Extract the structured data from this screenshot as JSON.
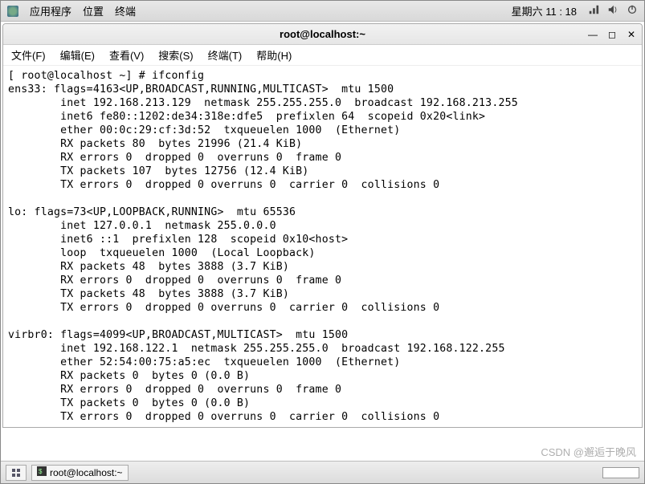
{
  "topbar": {
    "apps": "应用程序",
    "places": "位置",
    "terminal": "终端",
    "clock": "星期六 11 : 18"
  },
  "window": {
    "title": "root@localhost:~"
  },
  "menubar": {
    "file": "文件(F)",
    "edit": "编辑(E)",
    "view": "查看(V)",
    "search": "搜索(S)",
    "terminal": "终端(T)",
    "help": "帮助(H)"
  },
  "terminal": {
    "prompt": "[ root@localhost ~] # ifconfig",
    "lines": [
      "ens33: flags=4163<UP,BROADCAST,RUNNING,MULTICAST>  mtu 1500",
      "        inet 192.168.213.129  netmask 255.255.255.0  broadcast 192.168.213.255",
      "        inet6 fe80::1202:de34:318e:dfe5  prefixlen 64  scopeid 0x20<link>",
      "        ether 00:0c:29:cf:3d:52  txqueuelen 1000  (Ethernet)",
      "        RX packets 80  bytes 21996 (21.4 KiB)",
      "        RX errors 0  dropped 0  overruns 0  frame 0",
      "        TX packets 107  bytes 12756 (12.4 KiB)",
      "        TX errors 0  dropped 0 overruns 0  carrier 0  collisions 0",
      "",
      "lo: flags=73<UP,LOOPBACK,RUNNING>  mtu 65536",
      "        inet 127.0.0.1  netmask 255.0.0.0",
      "        inet6 ::1  prefixlen 128  scopeid 0x10<host>",
      "        loop  txqueuelen 1000  (Local Loopback)",
      "        RX packets 48  bytes 3888 (3.7 KiB)",
      "        RX errors 0  dropped 0  overruns 0  frame 0",
      "        TX packets 48  bytes 3888 (3.7 KiB)",
      "        TX errors 0  dropped 0 overruns 0  carrier 0  collisions 0",
      "",
      "virbr0: flags=4099<UP,BROADCAST,MULTICAST>  mtu 1500",
      "        inet 192.168.122.1  netmask 255.255.255.0  broadcast 192.168.122.255",
      "        ether 52:54:00:75:a5:ec  txqueuelen 1000  (Ethernet)",
      "        RX packets 0  bytes 0 (0.0 B)",
      "        RX errors 0  dropped 0  overruns 0  frame 0",
      "        TX packets 0  bytes 0 (0.0 B)",
      "        TX errors 0  dropped 0 overruns 0  carrier 0  collisions 0"
    ]
  },
  "taskbar": {
    "task1": "root@localhost:~"
  },
  "watermark": "CSDN @邂逅于晚风"
}
